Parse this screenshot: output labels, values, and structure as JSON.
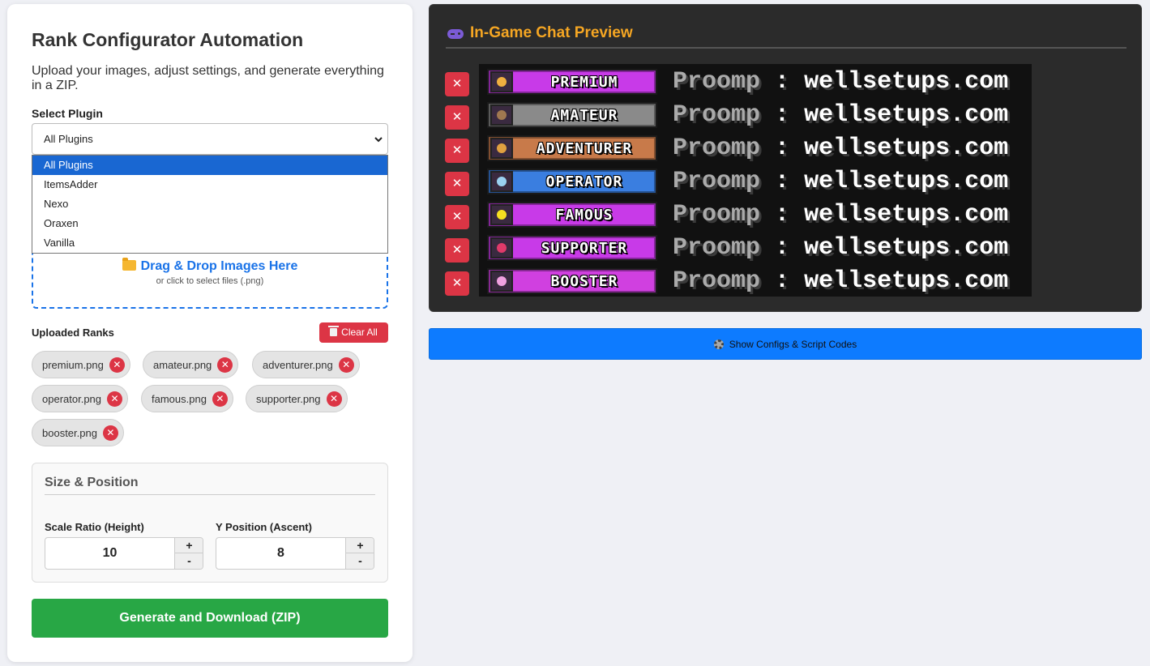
{
  "left": {
    "title": "Rank Configurator Automation",
    "subtitle": "Upload your images, adjust settings, and generate everything in a ZIP.",
    "select_plugin_label": "Select Plugin",
    "selected_plugin": "All Plugins",
    "plugin_options": [
      "All Plugins",
      "ItemsAdder",
      "Nexo",
      "Oraxen",
      "Vanilla"
    ],
    "dropzone": {
      "title": "Drag & Drop Images Here",
      "subtitle": "or click to select files (.png)",
      "icon": "folder-icon"
    },
    "uploaded_label": "Uploaded Ranks",
    "clear_all_label": "Clear All",
    "files": [
      "premium.png",
      "amateur.png",
      "adventurer.png",
      "operator.png",
      "famous.png",
      "supporter.png",
      "booster.png"
    ],
    "remove_glyph": "✕",
    "size_section": {
      "title": "Size & Position",
      "scale_label": "Scale Ratio (Height)",
      "scale_value": "10",
      "y_label": "Y Position (Ascent)",
      "y_value": "8",
      "plus": "+",
      "minus": "-"
    },
    "generate_label": "Generate and Download (ZIP)"
  },
  "preview": {
    "title": "In-Game Chat Preview",
    "icon": "gamepad-icon",
    "player_name": "Proomp",
    "separator": ":",
    "message": "wellsetups.com",
    "remove_glyph": "✕",
    "ranks": [
      {
        "label": "PREMIUM",
        "color": "#c83ae8",
        "icon_color": "#f0b040"
      },
      {
        "label": "AMATEUR",
        "color": "#8a8a8a",
        "icon_color": "#a07850"
      },
      {
        "label": "ADVENTURER",
        "color": "#c87a4a",
        "icon_color": "#e0a040"
      },
      {
        "label": "OPERATOR",
        "color": "#3a7ee0",
        "icon_color": "#9ad0f0"
      },
      {
        "label": "FAMOUS",
        "color": "#c83ae8",
        "icon_color": "#f5e020"
      },
      {
        "label": "SUPPORTER",
        "color": "#c83ae8",
        "icon_color": "#e03a6a"
      },
      {
        "label": "BOOSTER",
        "color": "#d040e0",
        "icon_color": "#f0a0e0"
      }
    ]
  },
  "show_configs_label": "Show Configs & Script Codes",
  "colors": {
    "accent_blue": "#1a73e8",
    "danger": "#dc3545",
    "success": "#28a745",
    "preview_title": "#f5a623",
    "configs_button": "#0d7bff"
  }
}
